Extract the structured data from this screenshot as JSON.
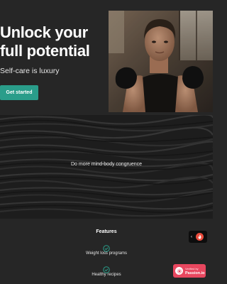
{
  "hero": {
    "title": "Unlock your full potential",
    "subtitle": "Self-care is luxury",
    "cta_label": "Get started",
    "cta_color": "#2a9d8a",
    "photo_alt": "woman-boxer-photo"
  },
  "banner": {
    "text": "Do more mind-body congruence"
  },
  "features": {
    "title": "Features",
    "accent": "#2a9d8a",
    "items": [
      {
        "label": "Weight loss programs",
        "icon": "check-circle-icon"
      },
      {
        "label": "Healthy recipes",
        "icon": "check-circle-icon"
      }
    ]
  },
  "widget": {
    "arrow": "‹",
    "icon": "flame-icon"
  },
  "badge": {
    "line1": "Verified by",
    "line2": "Passion.io",
    "color": "#e8475f"
  }
}
